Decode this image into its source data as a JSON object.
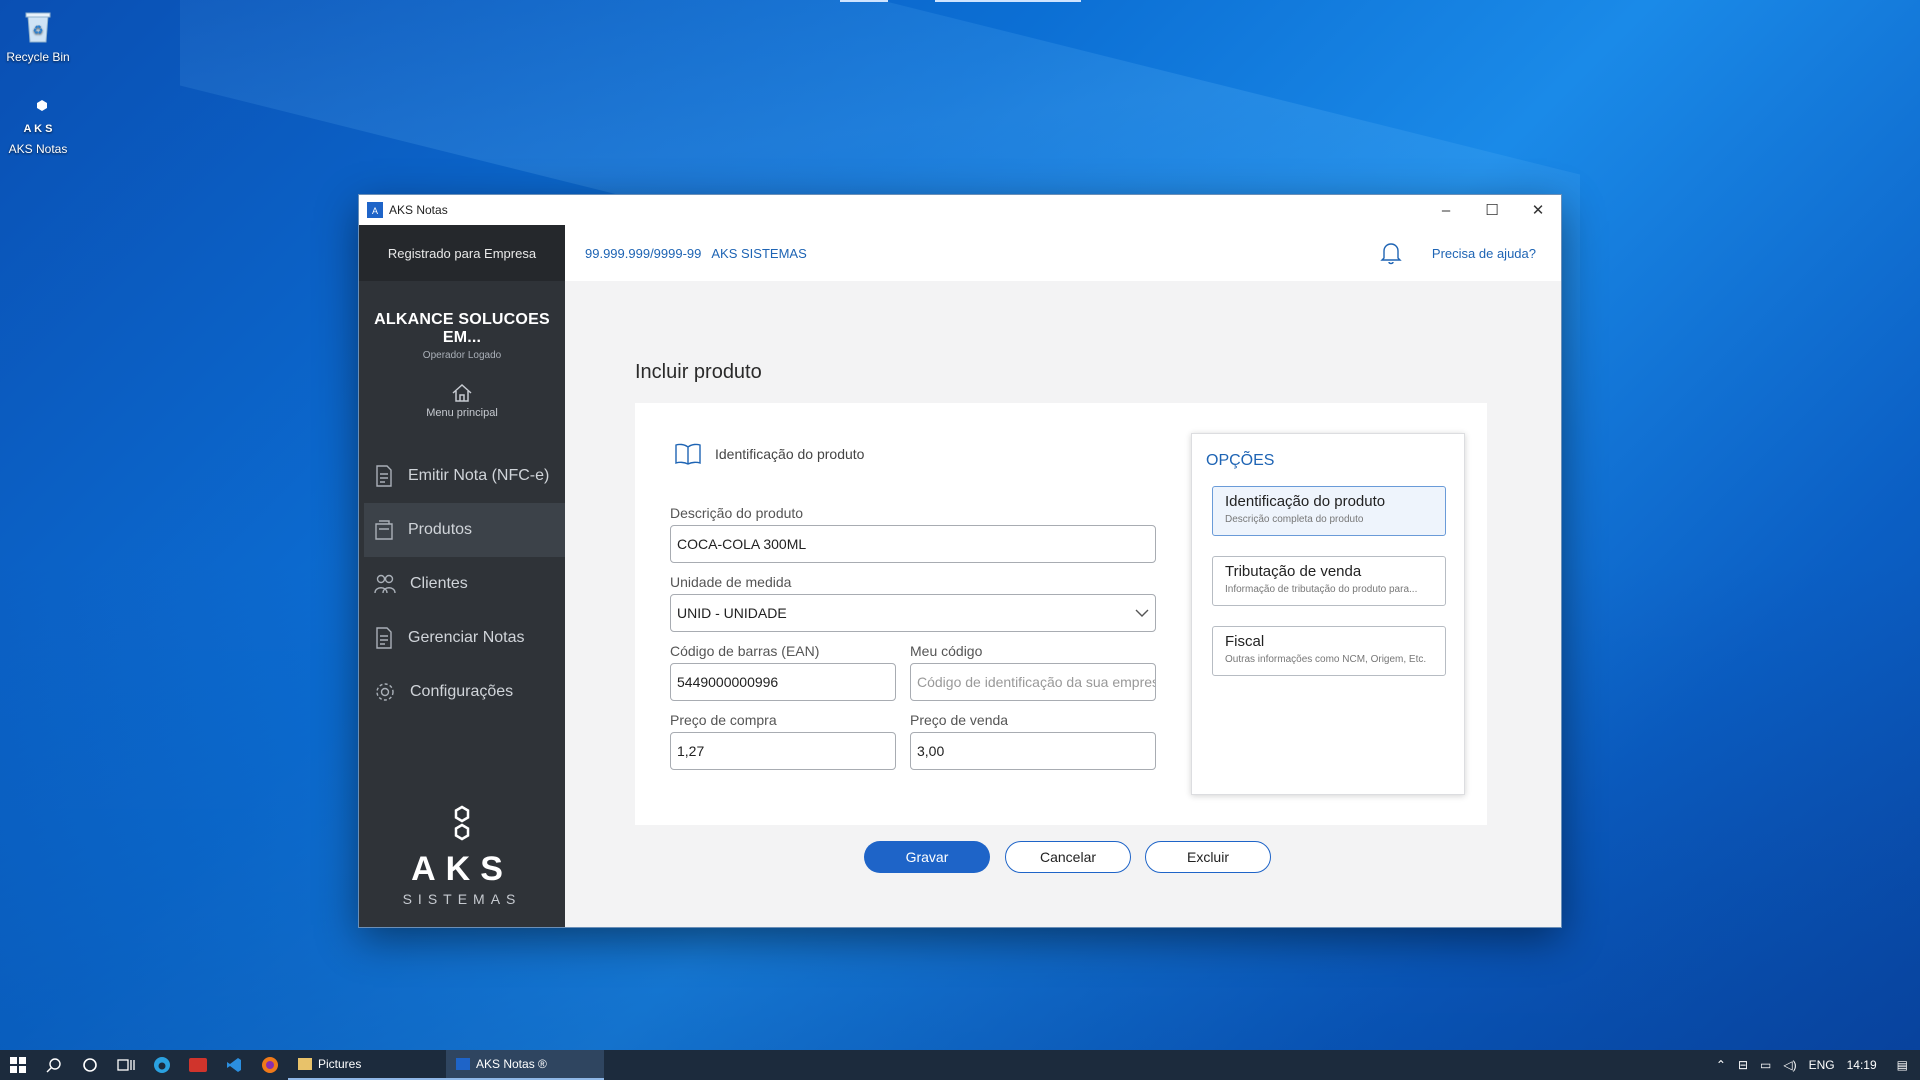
{
  "desktop": {
    "icons": [
      {
        "label": "Recycle Bin"
      },
      {
        "label": "AKS Notas"
      }
    ]
  },
  "window": {
    "title": "AKS Notas",
    "controls": {
      "minimize": "–",
      "maximize": "☐",
      "close": "✕"
    }
  },
  "sidebar": {
    "registered": "Registrado para Empresa",
    "company_name": "ALKANCE SOLUCOES EM...",
    "operator": "Operador Logado",
    "home_label": "Menu principal",
    "items": [
      {
        "label": "Emitir Nota (NFC-e)",
        "icon": "document-icon"
      },
      {
        "label": "Produtos",
        "icon": "box-icon"
      },
      {
        "label": "Clientes",
        "icon": "users-icon"
      },
      {
        "label": "Gerenciar Notas",
        "icon": "document-icon"
      },
      {
        "label": "Configurações",
        "icon": "gear-icon"
      }
    ],
    "active_index": 1,
    "logo_text": "AKS",
    "logo_sub": "SISTEMAS"
  },
  "topbar": {
    "cnpj": "99.999.999/9999-99",
    "company": "AKS SISTEMAS",
    "help": "Precisa de ajuda?"
  },
  "form": {
    "page_title": "Incluir produto",
    "section_title": "Identificação do produto",
    "description_label": "Descrição do produto",
    "description_value": "COCA-COLA 300ML",
    "unit_label": "Unidade de medida",
    "unit_value": "UNID - UNIDADE",
    "ean_label": "Código de barras (EAN)",
    "ean_value": "5449000000996",
    "mycode_label": "Meu código",
    "mycode_placeholder": "Código de identificação da sua empresa",
    "buy_price_label": "Preço de compra",
    "buy_price_value": "1,27",
    "sell_price_label": "Preço de venda",
    "sell_price_value": "3,00"
  },
  "options": {
    "title": "OPÇÕES",
    "items": [
      {
        "title": "Identificação do produto",
        "desc": "Descrição completa do produto"
      },
      {
        "title": "Tributação de venda",
        "desc": "Informação de tributação do produto para..."
      },
      {
        "title": "Fiscal",
        "desc": "Outras informações como NCM, Origem, Etc."
      }
    ]
  },
  "buttons": {
    "save": "Gravar",
    "cancel": "Cancelar",
    "delete": "Excluir"
  },
  "taskbar": {
    "tasks": [
      {
        "label": "Pictures"
      },
      {
        "label": "AKS Notas ®"
      }
    ],
    "tray": {
      "lang": "ENG",
      "time": "14:19"
    }
  },
  "colors": {
    "accent": "#1e64c8",
    "sidebar_bg": "#2f3338",
    "link": "#1e64b4"
  }
}
